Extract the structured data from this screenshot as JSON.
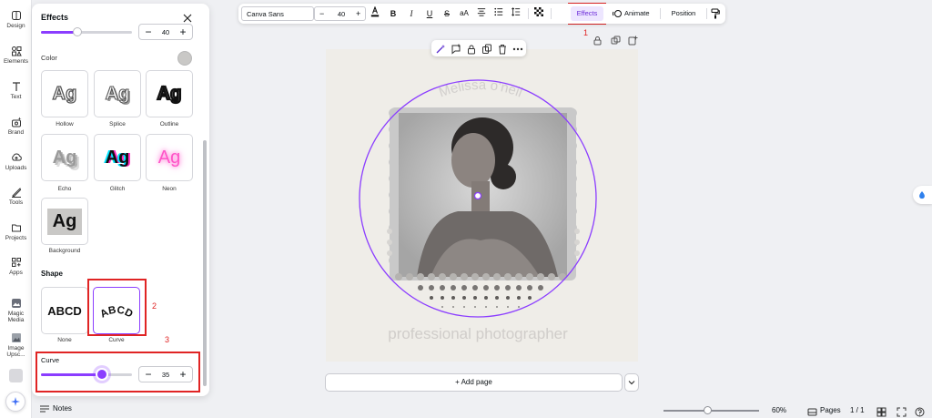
{
  "rail": {
    "items": [
      {
        "label": "Design",
        "icon": "design-icon"
      },
      {
        "label": "Elements",
        "icon": "elements-icon"
      },
      {
        "label": "Text",
        "icon": "text-icon"
      },
      {
        "label": "Brand",
        "icon": "brand-icon"
      },
      {
        "label": "Uploads",
        "icon": "uploads-icon"
      },
      {
        "label": "Tools",
        "icon": "tools-icon"
      },
      {
        "label": "Projects",
        "icon": "projects-icon"
      },
      {
        "label": "Apps",
        "icon": "apps-icon"
      },
      {
        "label": "Magic Media",
        "icon": "magic-media-icon"
      },
      {
        "label": "Image Upsc...",
        "icon": "image-upscaler-icon"
      }
    ]
  },
  "panel": {
    "title": "Effects",
    "top_stepper_value": "40",
    "color_label": "Color",
    "effect_tiles": [
      {
        "sample": "Ag",
        "label": "Hollow"
      },
      {
        "sample": "Ag",
        "label": "Splice"
      },
      {
        "sample": "Ag",
        "label": "Outline"
      },
      {
        "sample": "Ag",
        "label": "Echo"
      },
      {
        "sample": "Ag",
        "label": "Glitch"
      },
      {
        "sample": "Ag",
        "label": "Neon"
      },
      {
        "sample": "Ag",
        "label": "Background"
      }
    ],
    "shape_title": "Shape",
    "shapes": [
      {
        "sample": "ABCD",
        "label": "None"
      },
      {
        "sample": "ABCD",
        "label": "Curve"
      }
    ],
    "curve_label": "Curve",
    "curve_value": "35",
    "curve_level": 0.67,
    "top_slider_level": 0.4
  },
  "annotations": [
    "1",
    "2",
    "3"
  ],
  "toolbar": {
    "font": "Canva Sans",
    "size": "40",
    "minus": "−",
    "plus": "+",
    "effects": "Effects",
    "animate": "Animate",
    "position": "Position"
  },
  "canvas": {
    "name_text": "Melissa o'neil",
    "subtitle": "professional photographer"
  },
  "add_page": "+ Add page",
  "bottom": {
    "notes": "Notes",
    "zoom": "60%",
    "pages": "Pages",
    "page_count": "1 / 1"
  },
  "colors": {
    "accent": "#8b3dff",
    "annotation": "#e02424",
    "canvas_bg": "#efede8"
  }
}
